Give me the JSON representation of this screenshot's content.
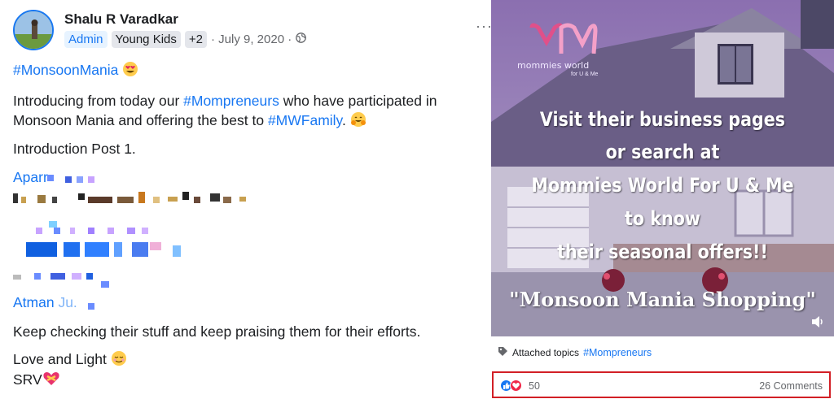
{
  "post": {
    "author": "Shalu R Varadkar",
    "badges": [
      "Admin",
      "Young Kids",
      "+2"
    ],
    "date": "· July 9, 2020 ·",
    "more": "···",
    "hashtag_title": "#MonsoonMania",
    "intro_part1": "Introducing from today our ",
    "intro_link": "#Mompreneurs",
    "intro_part2": " who have participated in",
    "intro_line2a": "Monsoon Mania and offering the best to ",
    "intro_line2_link": "#MWFamily",
    "intro_line2b": ".",
    "intro_post": "Introduction Post 1.",
    "name1_partial": "Aparr",
    "name2_partial": "Atman",
    "name2_suffix": "Ju.",
    "closing": "Keep checking their stuff and keep praising them for their efforts.",
    "love": "Love and Light",
    "signature": "SRV"
  },
  "media": {
    "brand_line1": "mommies world",
    "brand_line2": "for U & Me",
    "lines": [
      "Visit their business pages",
      "or search at",
      "Mommies World For U & Me",
      "to know",
      "their seasonal offers!!"
    ],
    "quote": "\"Monsoon Mania Shopping\""
  },
  "topics": {
    "label": "Attached topics",
    "topic": "#Mompreneurs"
  },
  "footer": {
    "reaction_count": "50",
    "comments": "26 Comments"
  },
  "colors": {
    "link": "#1877f2",
    "highlight_border": "#d21f26"
  }
}
